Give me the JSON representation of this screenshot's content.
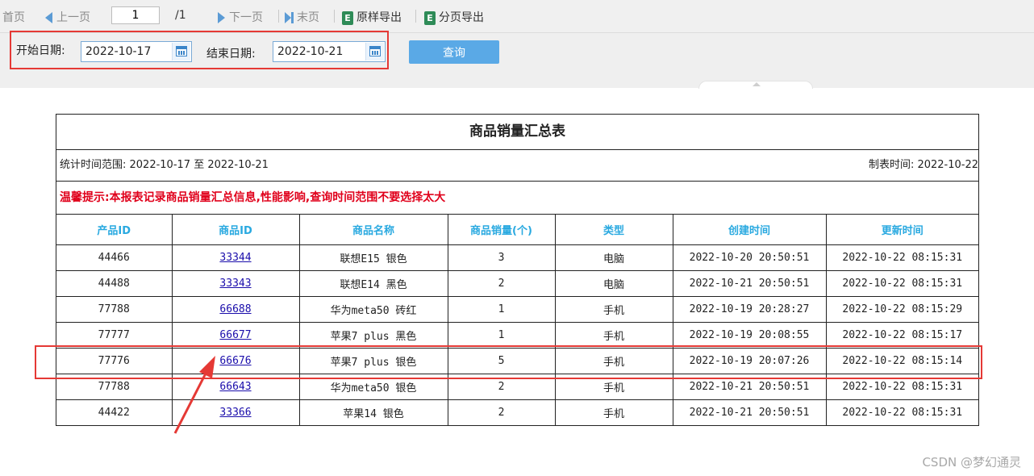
{
  "toolbar": {
    "first": "首页",
    "prev": "上一页",
    "page_value": "1",
    "page_total": "/1",
    "next": "下一页",
    "last": "末页",
    "export_original": "原样导出",
    "export_paged": "分页导出",
    "excel_icon_letter": "E"
  },
  "query": {
    "start_label": "开始日期:",
    "start_value": "2022-10-17",
    "end_label": "结束日期:",
    "end_value": "2022-10-21",
    "button": "查询"
  },
  "report": {
    "title": "商品销量汇总表",
    "range_text": "统计时间范围: 2022-10-17 至 2022-10-21",
    "made_time": "制表时间: 2022-10-22",
    "tip": "温馨提示:本报表记录商品销量汇总信息,性能影响,查询时间范围不要选择太大",
    "columns": [
      "产品ID",
      "商品ID",
      "商品名称",
      "商品销量(个)",
      "类型",
      "创建时间",
      "更新时间"
    ],
    "rows": [
      {
        "product_id": "44466",
        "goods_id": "33344",
        "name": "联想E15 银色",
        "qty": "3",
        "type": "电脑",
        "created": "2022-10-20 20:50:51",
        "updated": "2022-10-22 08:15:31"
      },
      {
        "product_id": "44488",
        "goods_id": "33343",
        "name": "联想E14 黑色",
        "qty": "2",
        "type": "电脑",
        "created": "2022-10-21 20:50:51",
        "updated": "2022-10-22 08:15:31"
      },
      {
        "product_id": "77788",
        "goods_id": "66688",
        "name": "华为meta50 砖红",
        "qty": "1",
        "type": "手机",
        "created": "2022-10-19 20:28:27",
        "updated": "2022-10-22 08:15:29"
      },
      {
        "product_id": "77777",
        "goods_id": "66677",
        "name": "苹果7 plus 黑色",
        "qty": "1",
        "type": "手机",
        "created": "2022-10-19 20:08:55",
        "updated": "2022-10-22 08:15:17"
      },
      {
        "product_id": "77776",
        "goods_id": "66676",
        "name": "苹果7 plus 银色",
        "qty": "5",
        "type": "手机",
        "created": "2022-10-19 20:07:26",
        "updated": "2022-10-22 08:15:14"
      },
      {
        "product_id": "77788",
        "goods_id": "66643",
        "name": "华为meta50 银色",
        "qty": "2",
        "type": "手机",
        "created": "2022-10-21 20:50:51",
        "updated": "2022-10-22 08:15:31"
      },
      {
        "product_id": "44422",
        "goods_id": "33366",
        "name": "苹果14 银色",
        "qty": "2",
        "type": "手机",
        "created": "2022-10-21 20:50:51",
        "updated": "2022-10-22 08:15:31"
      }
    ]
  },
  "watermark": "CSDN @梦幻通灵",
  "colors": {
    "accent": "#29a9e0",
    "button": "#5aa9e6",
    "highlight": "#e53935",
    "tip": "#e0001b"
  }
}
